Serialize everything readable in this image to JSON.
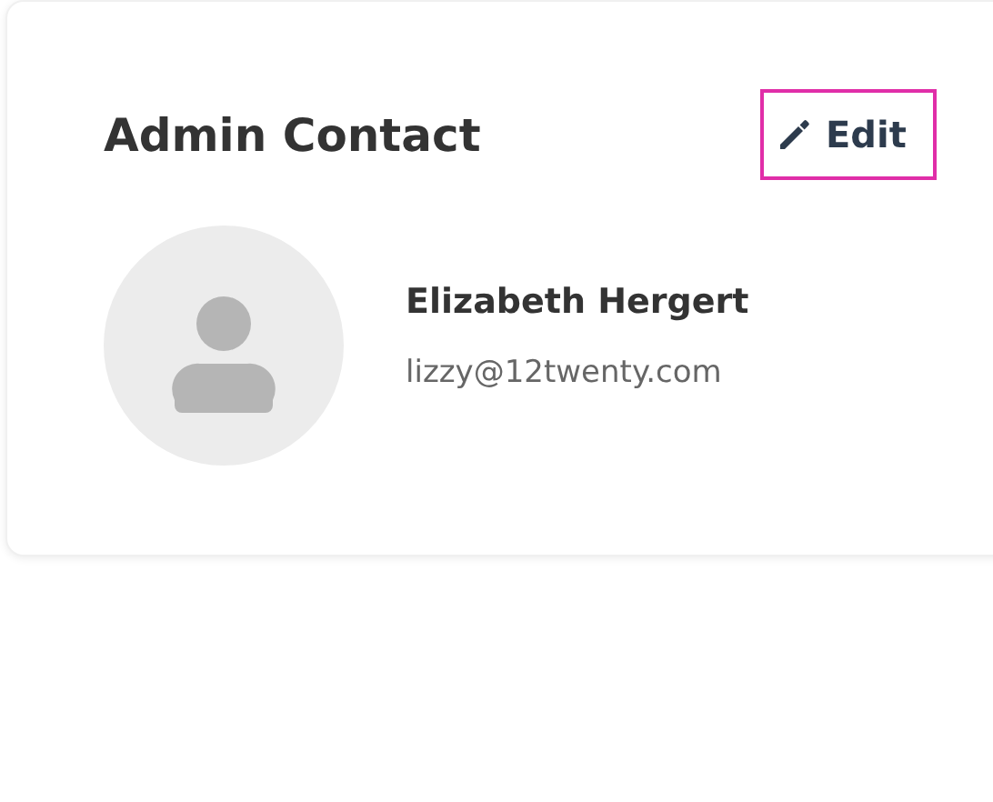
{
  "card": {
    "title": "Admin Contact",
    "edit_button": {
      "label": "Edit"
    },
    "contact": {
      "name": "Elizabeth Hergert",
      "email": "lizzy@12twenty.com"
    }
  }
}
